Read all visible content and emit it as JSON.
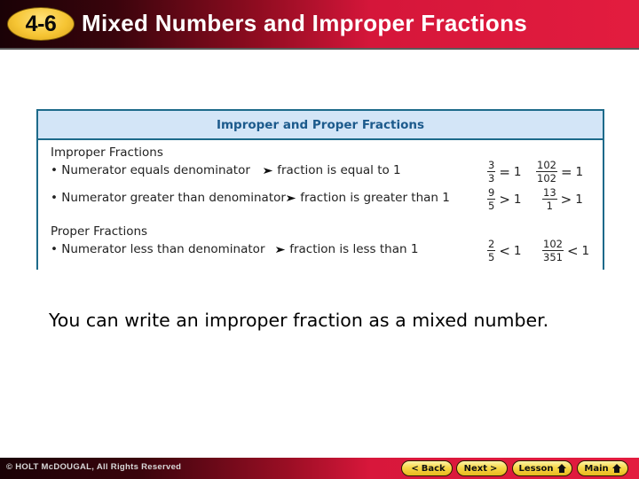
{
  "header": {
    "lesson_number": "4-6",
    "title": "Mixed Numbers and Improper Fractions"
  },
  "concept_box": {
    "heading": "Improper and Proper Fractions",
    "sections": [
      {
        "title": "Improper Fractions",
        "rows": [
          {
            "condition": "• Numerator equals denominator",
            "result": "fraction is equal to 1",
            "examples": [
              {
                "num": "3",
                "den": "3",
                "relation": "=",
                "rhs": "1"
              },
              {
                "num": "102",
                "den": "102",
                "relation": "=",
                "rhs": "1"
              }
            ]
          },
          {
            "condition": "• Numerator greater than denominator",
            "result": "fraction is greater than 1",
            "examples": [
              {
                "num": "9",
                "den": "5",
                "relation": ">",
                "rhs": "1"
              },
              {
                "num": "13",
                "den": "1",
                "relation": ">",
                "rhs": "1"
              }
            ]
          }
        ]
      },
      {
        "title": "Proper Fractions",
        "rows": [
          {
            "condition": "• Numerator less than denominator",
            "result": "fraction is less than 1",
            "examples": [
              {
                "num": "2",
                "den": "5",
                "relation": "<",
                "rhs": "1"
              },
              {
                "num": "102",
                "den": "351",
                "relation": "<",
                "rhs": "1"
              }
            ]
          }
        ]
      }
    ],
    "arrow_icon": "arrow-right-icon"
  },
  "body": {
    "text": "You can write an improper fraction as a mixed number."
  },
  "footer": {
    "copyright": "© HOLT McDOUGAL, All Rights Reserved",
    "nav": {
      "back": "Back",
      "next": "Next",
      "lesson": "Lesson",
      "main": "Main"
    },
    "icons": {
      "back": "chevron-left-icon",
      "next": "chevron-right-icon",
      "lesson": "home-icon",
      "main": "home-icon"
    }
  },
  "colors": {
    "title_red": "#e31c3f",
    "title_dark": "#1a0206",
    "badge_yellow": "#f6c534",
    "box_border": "#1d6a8a",
    "box_header_bg": "#d3e5f7",
    "box_header_text": "#1c5a8c"
  }
}
